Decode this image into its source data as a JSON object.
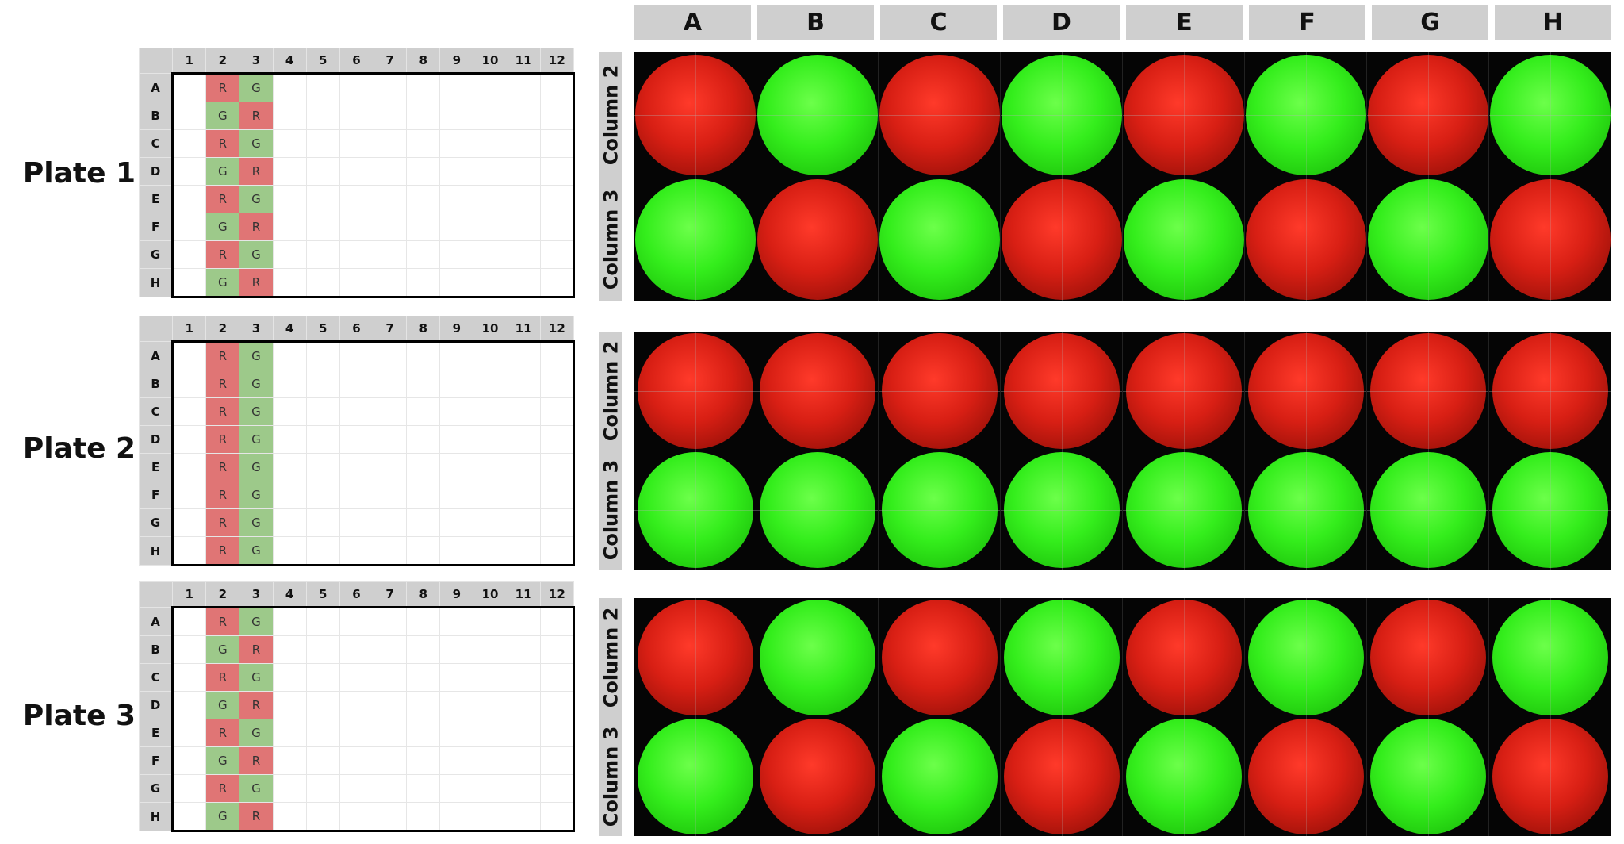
{
  "plates": [
    {
      "label": "Plate 1",
      "row_labels": [
        "A",
        "B",
        "C",
        "D",
        "E",
        "F",
        "G",
        "H"
      ],
      "column_labels": [
        "1",
        "2",
        "3",
        "4",
        "5",
        "6",
        "7",
        "8",
        "9",
        "10",
        "11",
        "12"
      ],
      "col2": [
        "R",
        "G",
        "R",
        "G",
        "R",
        "G",
        "R",
        "G"
      ],
      "col3": [
        "G",
        "R",
        "G",
        "R",
        "G",
        "R",
        "G",
        "R"
      ]
    },
    {
      "label": "Plate 2",
      "row_labels": [
        "A",
        "B",
        "C",
        "D",
        "E",
        "F",
        "G",
        "H"
      ],
      "column_labels": [
        "1",
        "2",
        "3",
        "4",
        "5",
        "6",
        "7",
        "8",
        "9",
        "10",
        "11",
        "12"
      ],
      "col2": [
        "R",
        "R",
        "R",
        "R",
        "R",
        "R",
        "R",
        "R"
      ],
      "col3": [
        "G",
        "G",
        "G",
        "G",
        "G",
        "G",
        "G",
        "G"
      ]
    },
    {
      "label": "Plate 3",
      "row_labels": [
        "A",
        "B",
        "C",
        "D",
        "E",
        "F",
        "G",
        "H"
      ],
      "column_labels": [
        "1",
        "2",
        "3",
        "4",
        "5",
        "6",
        "7",
        "8",
        "9",
        "10",
        "11",
        "12"
      ],
      "col2": [
        "R",
        "G",
        "R",
        "G",
        "R",
        "G",
        "R",
        "G"
      ],
      "col3": [
        "G",
        "R",
        "G",
        "R",
        "G",
        "R",
        "G",
        "R"
      ]
    }
  ],
  "well_header": [
    "A",
    "B",
    "C",
    "D",
    "E",
    "F",
    "G",
    "H"
  ],
  "image_rows": [
    "Column 2",
    "Column 3"
  ],
  "colors": {
    "R": "#e07575",
    "G": "#9dc98a",
    "header": "#cfcfcf",
    "red_fluor": "#d81f14",
    "green_fluor": "#34ee1c"
  }
}
